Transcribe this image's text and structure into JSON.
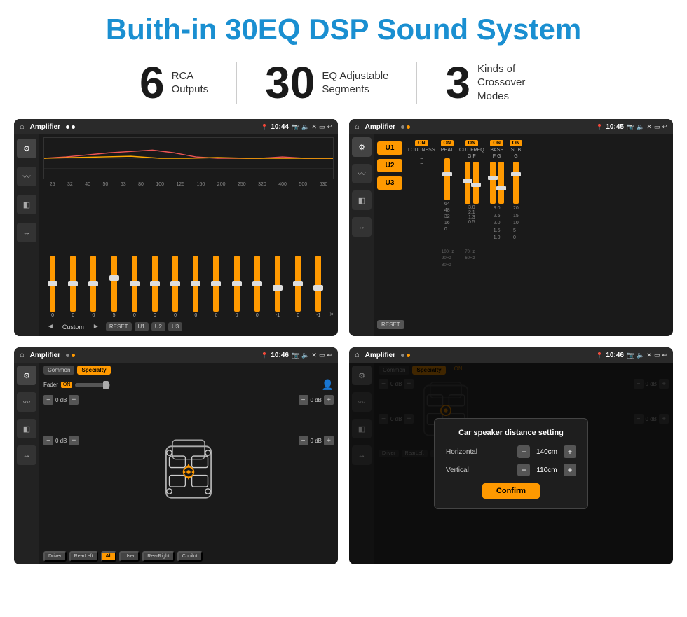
{
  "header": {
    "title": "Buith-in 30EQ DSP Sound System"
  },
  "stats": [
    {
      "number": "6",
      "line1": "RCA",
      "line2": "Outputs"
    },
    {
      "number": "30",
      "line1": "EQ Adjustable",
      "line2": "Segments"
    },
    {
      "number": "3",
      "line1": "Kinds of",
      "line2": "Crossover Modes"
    }
  ],
  "screens": {
    "eq": {
      "status": {
        "app": "Amplifier",
        "time": "10:44"
      },
      "freq_labels": [
        "25",
        "32",
        "40",
        "50",
        "63",
        "80",
        "100",
        "125",
        "160",
        "200",
        "250",
        "320",
        "400",
        "500",
        "630"
      ],
      "sliders": [
        {
          "val": "0",
          "pos": 50
        },
        {
          "val": "0",
          "pos": 50
        },
        {
          "val": "0",
          "pos": 50
        },
        {
          "val": "5",
          "pos": 40
        },
        {
          "val": "0",
          "pos": 50
        },
        {
          "val": "0",
          "pos": 50
        },
        {
          "val": "0",
          "pos": 50
        },
        {
          "val": "0",
          "pos": 50
        },
        {
          "val": "0",
          "pos": 50
        },
        {
          "val": "0",
          "pos": 50
        },
        {
          "val": "0",
          "pos": 50
        },
        {
          "val": "-1",
          "pos": 55
        },
        {
          "val": "0",
          "pos": 50
        },
        {
          "val": "-1",
          "pos": 55
        }
      ],
      "mode": "Custom",
      "buttons": [
        "RESET",
        "U1",
        "U2",
        "U3"
      ]
    },
    "crossover": {
      "status": {
        "app": "Amplifier",
        "time": "10:45"
      },
      "u_buttons": [
        "U1",
        "U2",
        "U3"
      ],
      "controls": [
        {
          "label": "LOUDNESS",
          "on": true
        },
        {
          "label": "PHAT",
          "on": true
        },
        {
          "label": "CUT FREQ",
          "on": true
        },
        {
          "label": "BASS",
          "on": true
        },
        {
          "label": "SUB",
          "on": true
        }
      ],
      "reset_label": "RESET"
    },
    "speaker": {
      "status": {
        "app": "Amplifier",
        "time": "10:46"
      },
      "tabs": [
        "Common",
        "Specialty"
      ],
      "active_tab": "Specialty",
      "fader_label": "Fader",
      "fader_on": "ON",
      "db_values": [
        "0 dB",
        "0 dB",
        "0 dB",
        "0 dB"
      ],
      "buttons": [
        "Driver",
        "RearLeft",
        "All",
        "User",
        "RearRight",
        "Copilot"
      ]
    },
    "dialog": {
      "status": {
        "app": "Amplifier",
        "time": "10:46"
      },
      "tabs": [
        "Common",
        "Specialty"
      ],
      "active_tab": "Specialty",
      "title": "Car speaker distance setting",
      "horizontal_label": "Horizontal",
      "horizontal_value": "140cm",
      "vertical_label": "Vertical",
      "vertical_value": "110cm",
      "confirm_label": "Confirm",
      "db_values": [
        "0 dB",
        "0 dB"
      ],
      "buttons": [
        "Driver",
        "RearLeft",
        "All",
        "User",
        "RearRight",
        "Copilot"
      ]
    }
  }
}
